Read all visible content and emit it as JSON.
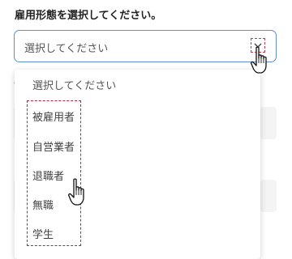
{
  "form": {
    "label": "雇用形態を選択してください。",
    "select_value": "選択してください"
  },
  "dropdown": {
    "placeholder": "選択してください",
    "options": [
      "被雇用者",
      "自営業者",
      "退職者",
      "無職",
      "学生"
    ]
  },
  "colors": {
    "select_border": "#5b8fd6",
    "highlight_dash": "#b02a3c"
  },
  "icons": [
    "chevron-down-icon",
    "hand-pointer-icon"
  ]
}
